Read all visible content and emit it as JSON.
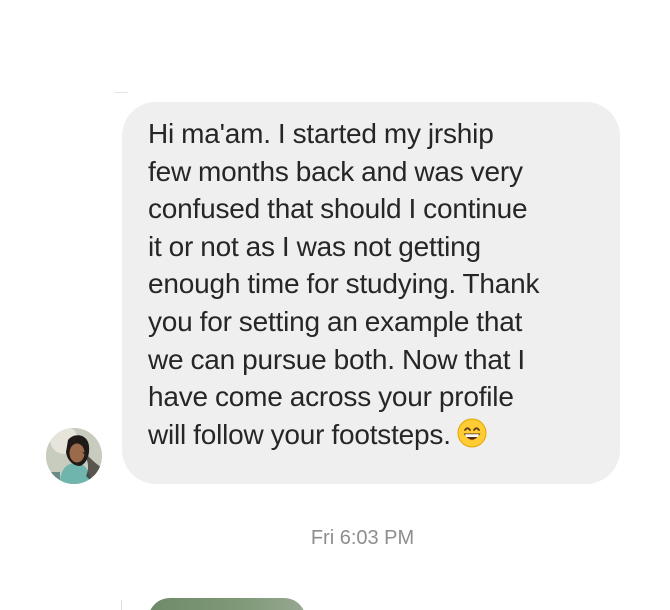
{
  "message": {
    "text": "Hi ma'am. I started my jrship few months back and was very confused that should I continue it or not as I was not getting enough time for studying. Thank you for setting an example that we can pursue both. Now that I have come across your profile will follow your footsteps.",
    "lines": [
      "Hi ma'am. I started my jrship",
      "few months back and was very",
      "confused that should I continue",
      "it or not as I was not getting",
      "enough time for studying. Thank",
      "you for setting an example that",
      "we can pursue both. Now that I",
      "have come across your profile",
      "will follow your footsteps."
    ],
    "emoji": "grinning-face-with-smiling-eyes-icon",
    "bubble_color": "#efefef",
    "text_color": "#262626"
  },
  "sender": {
    "avatar": "profile-photo"
  },
  "timestamp": "Fri 6:03 PM",
  "next_message": {
    "type": "image-attachment"
  }
}
